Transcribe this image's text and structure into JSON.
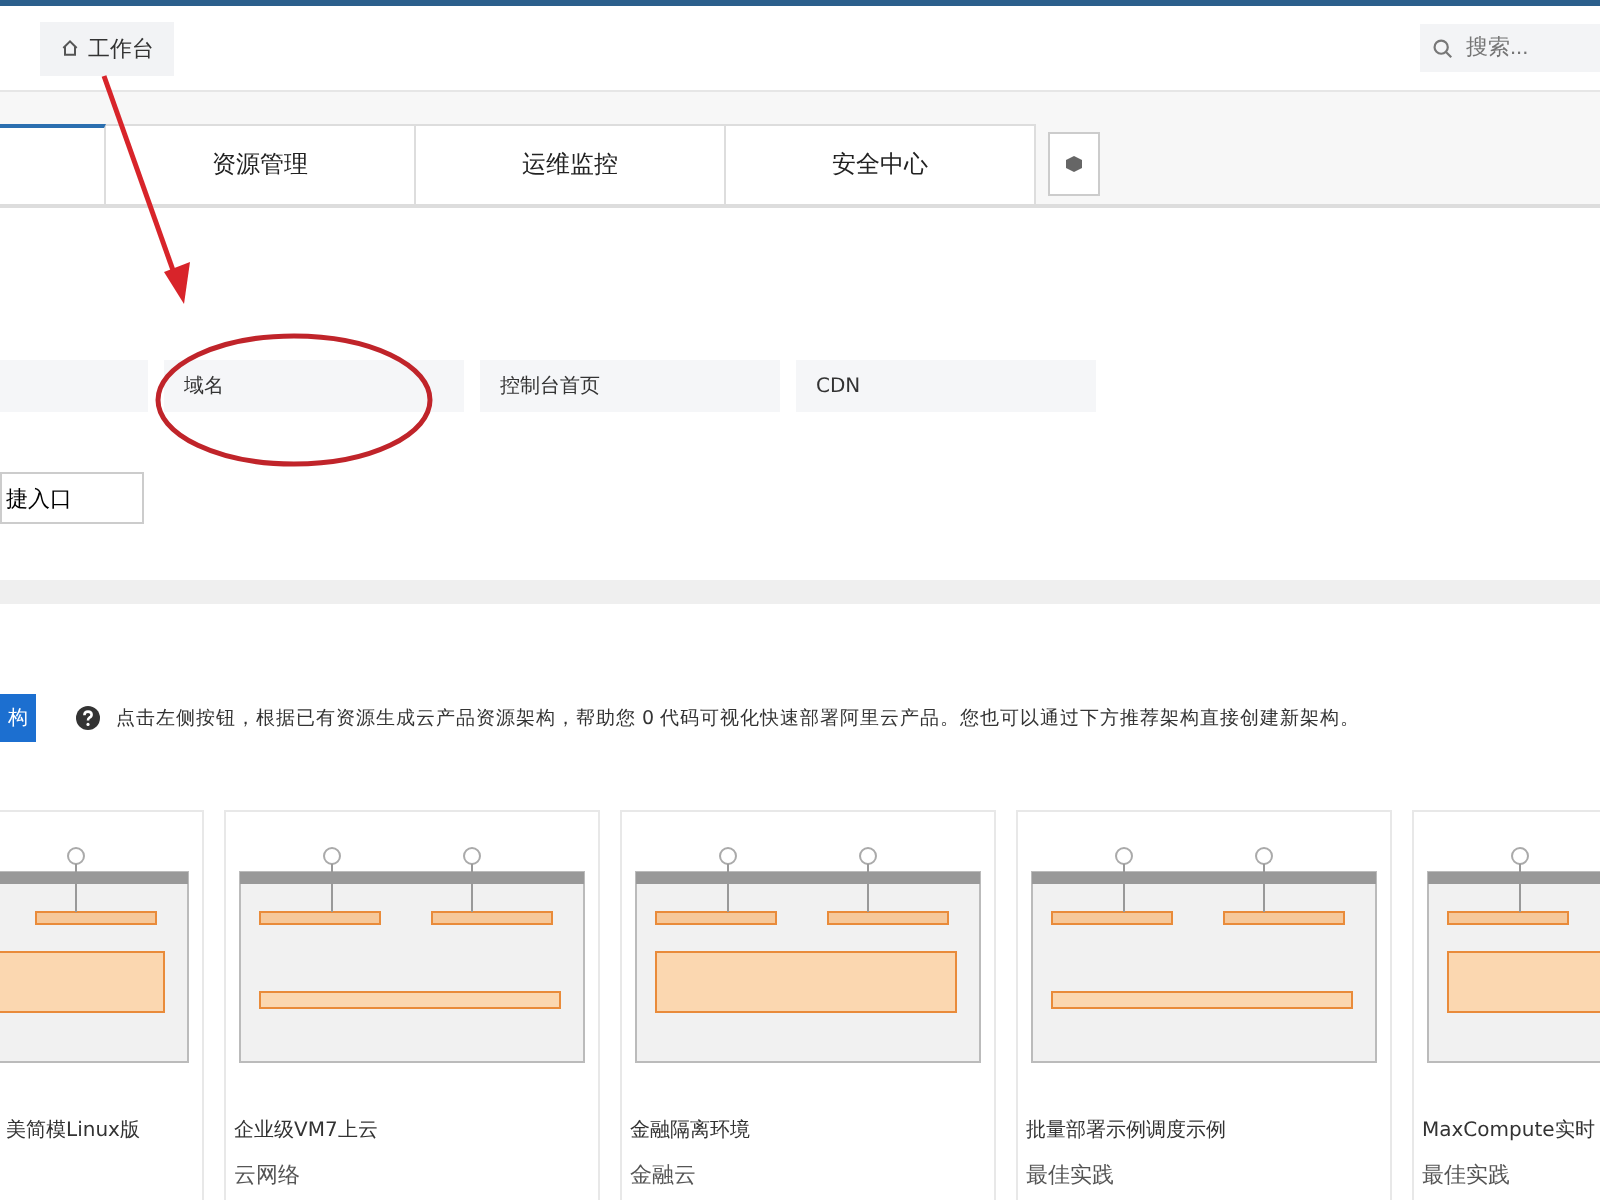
{
  "topbar": {
    "breadcrumb": "工作台",
    "search": {
      "placeholder": "搜索..."
    }
  },
  "tabs": [
    {
      "selected": true
    },
    {
      "label": "资源管理",
      "selected": false
    },
    {
      "label": "运维监控",
      "selected": false
    },
    {
      "label": "安全中心",
      "selected": false
    }
  ],
  "shortcuts": [
    {
      "label": "域名"
    },
    {
      "label": "控制台首页"
    },
    {
      "label": "CDN"
    }
  ],
  "shortcut_button": "捷入口",
  "architecture": {
    "button": "构",
    "info": "点击左侧按钮，根据已有资源生成云产品资源架构，帮助您 0 代码可视化快速部署阿里云产品。您也可以通过下方推荐架构直接创建新架构。"
  },
  "cards": [
    {
      "title": "美简模Linux版"
    },
    {
      "title": "企业级VM7上云",
      "subtitle": "云网络"
    },
    {
      "title": "金融隔离环境",
      "subtitle": "金融云"
    },
    {
      "title": "批量部署示例调度示例",
      "subtitle": "最佳实践"
    },
    {
      "title": "MaxCompute实时",
      "subtitle": "最佳实践"
    }
  ]
}
